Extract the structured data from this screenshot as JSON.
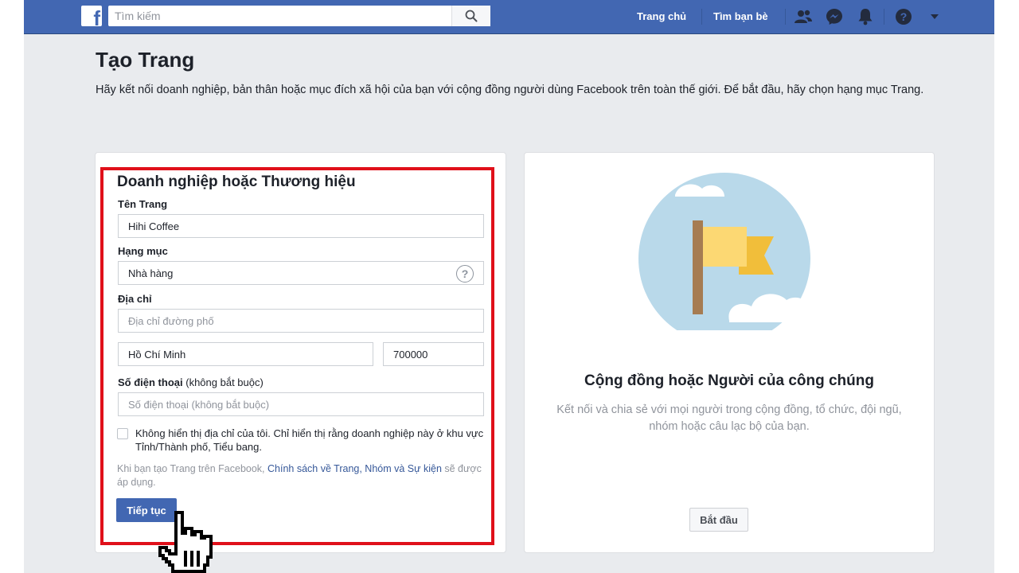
{
  "header": {
    "logo_text": "f",
    "search_placeholder": "Tìm kiếm",
    "nav": {
      "home": "Trang chủ",
      "find_friends": "Tìm bạn bè"
    },
    "icons": [
      "friends-icon",
      "messenger-icon",
      "notifications-icon",
      "help-icon",
      "dropdown-arrow-icon"
    ]
  },
  "page": {
    "title": "Tạo Trang",
    "description": "Hãy kết nối doanh nghiệp, bản thân hoặc mục đích xã hội của bạn với cộng đồng người dùng Facebook trên toàn thế giới. Để bắt đầu, hãy chọn hạng mục Trang."
  },
  "business_card": {
    "title": "Doanh nghiệp hoặc Thương hiệu",
    "page_name_label": "Tên Trang",
    "page_name_value": "Hihi Coffee",
    "category_label": "Hạng mục",
    "category_value": "Nhà hàng",
    "address_label": "Địa chỉ",
    "street_placeholder": "Địa chỉ đường phố",
    "city_value": "Hồ Chí Minh",
    "zip_value": "700000",
    "phone_label": "Số điện thoại",
    "phone_label_optional": "(không bắt buộc)",
    "phone_placeholder": "Số điện thoại (không bắt buộc)",
    "hide_address_label": "Không hiển thị địa chỉ của tôi. Chỉ hiển thị rằng doanh nghiệp này ở khu vực Tỉnh/Thành phố, Tiểu bang.",
    "policy_prefix": "Khi bạn tạo Trang trên Facebook, ",
    "policy_link": "Chính sách về Trang, Nhóm và Sự kiện",
    "policy_suffix": " sẽ được áp dụng.",
    "continue_label": "Tiếp tục"
  },
  "community_card": {
    "title": "Cộng đồng hoặc Người của công chúng",
    "description": "Kết nối và chia sẻ với mọi người trong cộng đồng, tổ chức, đội ngũ, nhóm hoặc câu lạc bộ của bạn.",
    "start_label": "Bắt đầu"
  },
  "colors": {
    "brand": "#4267b2",
    "highlight": "#e0101a",
    "flag_circle": "#b9d9ea",
    "flag_yellow": "#fcd873",
    "flag_dark_yellow": "#f1be3a",
    "pole": "#a67c52"
  }
}
